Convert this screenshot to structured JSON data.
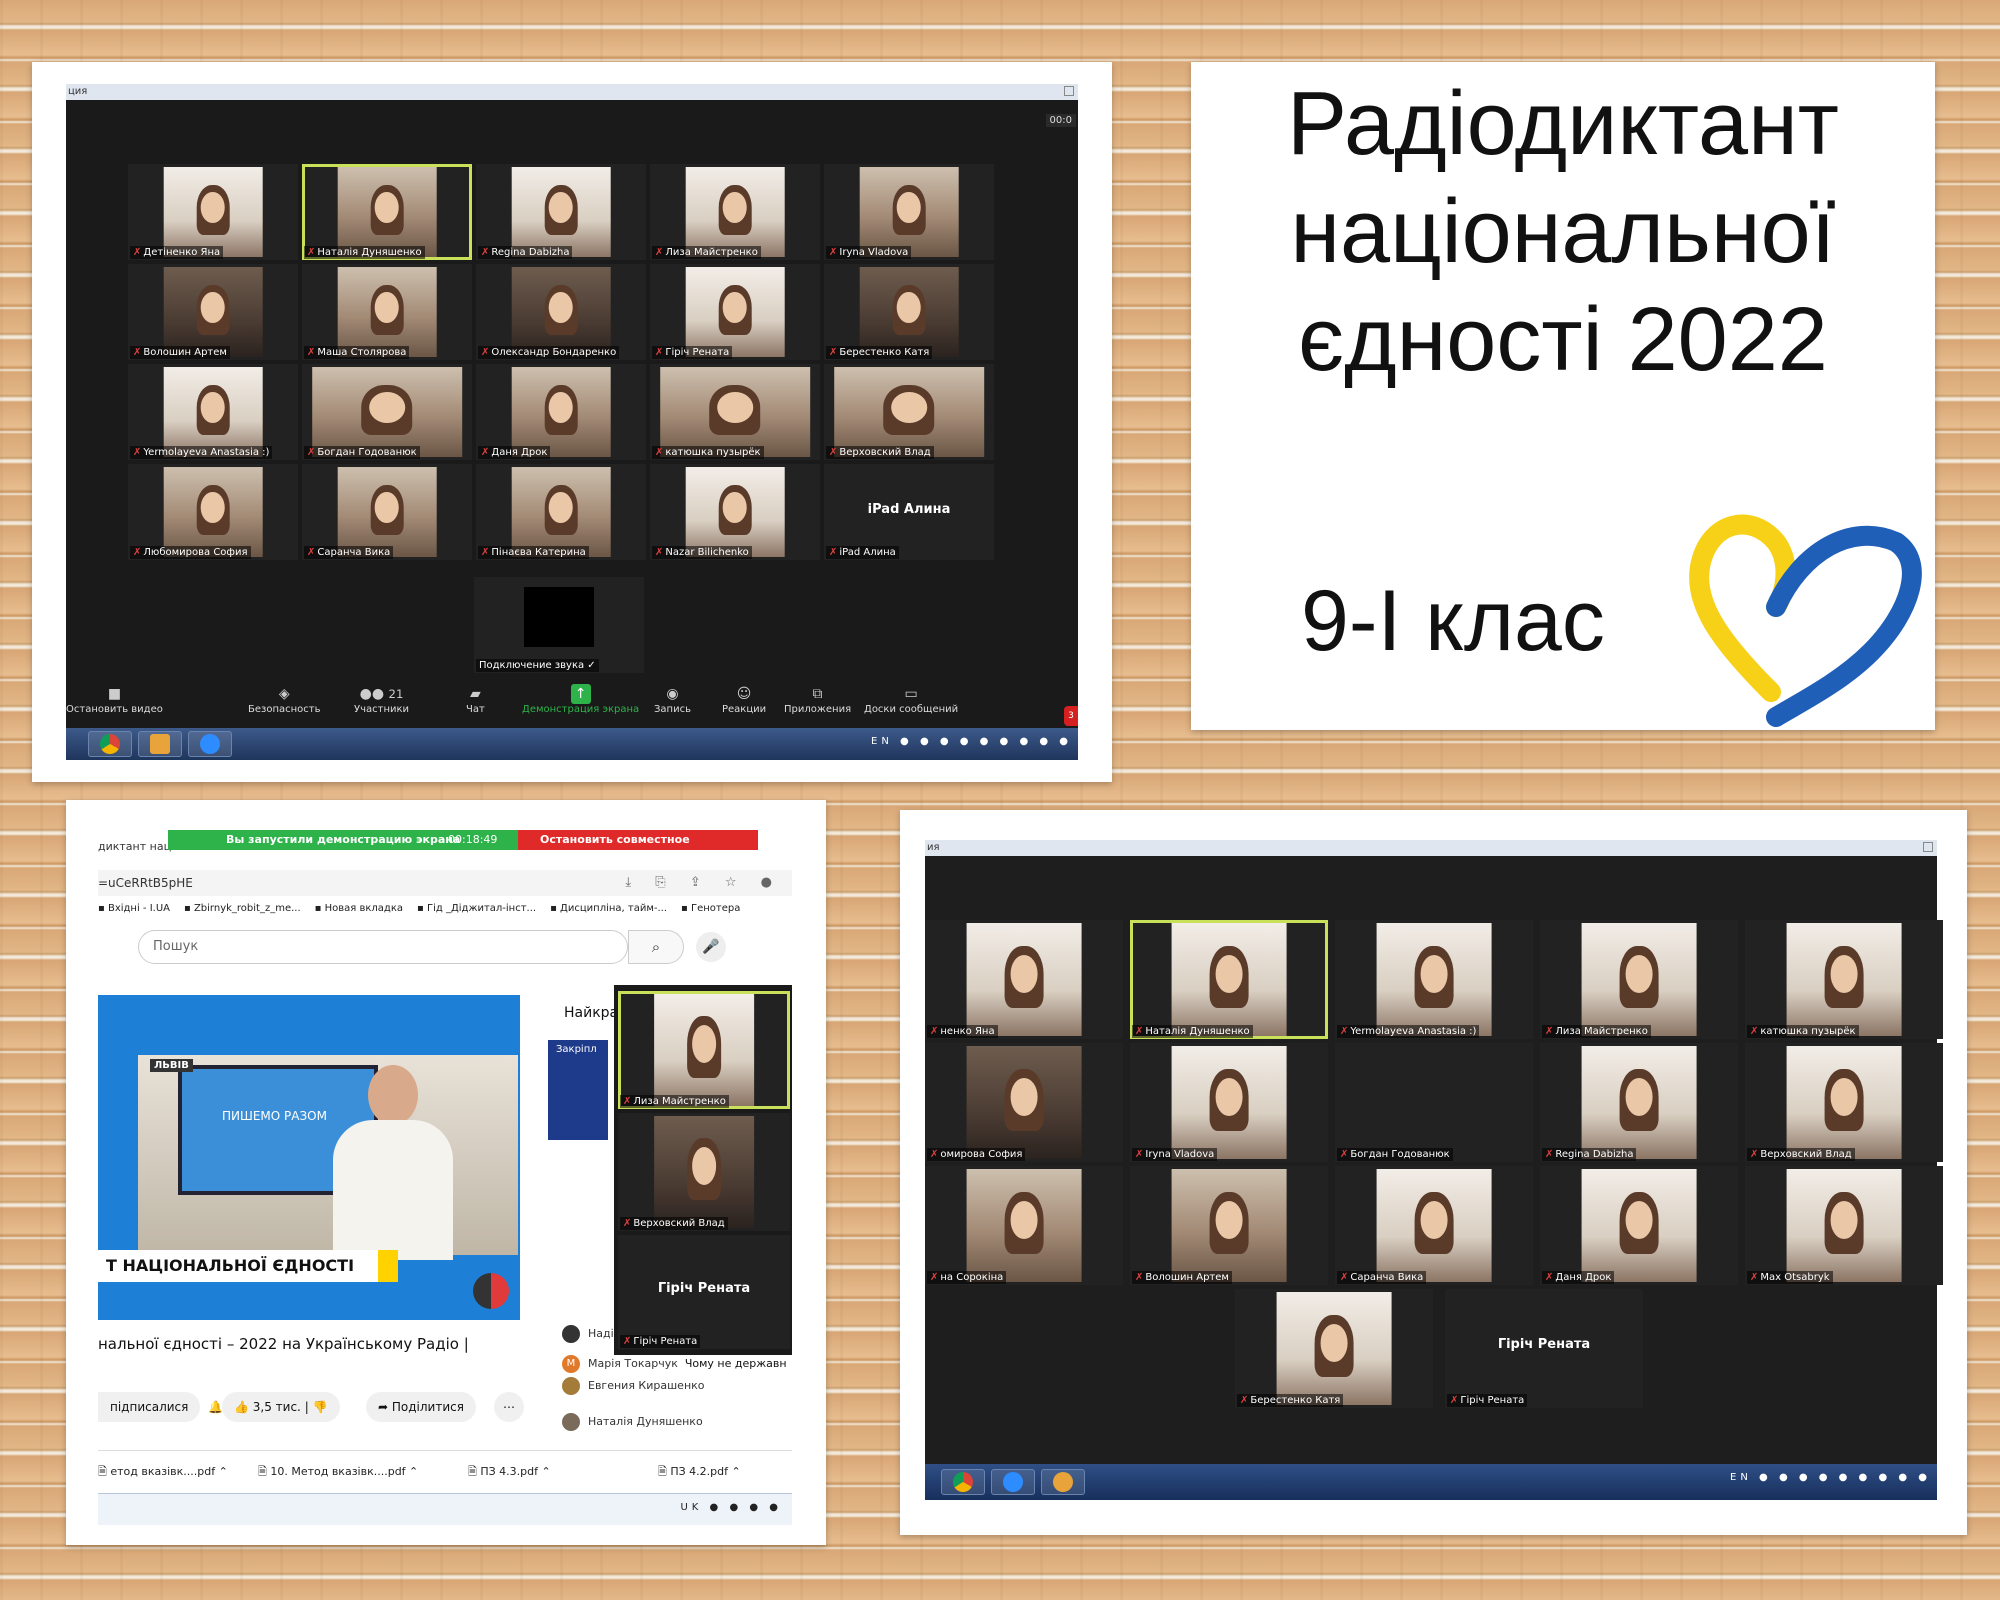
{
  "panel1": {
    "window_title": "ция",
    "timer": "00:0",
    "participants": [
      "Детіненко Яна",
      "Наталія Дуняшенко",
      "Regina Dabizha",
      "Лиза Майстренко",
      "Iryna Vladova",
      "Волошин Артем",
      "Маша Столярова",
      "Олександр Бондаренко",
      "Гіріч Рената",
      "Берестенко Катя",
      "Yermolayeva Anastasia :)",
      "Богдан Годованюк",
      "Даня Дрок",
      "катюшка пузырёк",
      "Верховский Влад",
      "Любомирова София",
      "Саранча Вика",
      "Пінаєва Катерина",
      "Nazar Bilichenko",
      "iPad Алина"
    ],
    "ipad_big": "iPad Алина",
    "audio_tile": "Подключение звука ✓",
    "toolbar": {
      "video": "Остановить видео",
      "security": "Безопасность",
      "participants": "Участники",
      "participants_count": "21",
      "chat": "Чат",
      "share": "Демонстрация экрана",
      "record": "Запись",
      "reactions": "Реакции",
      "apps": "Приложения",
      "whiteboard": "Доски сообщений"
    },
    "tray": "EN"
  },
  "card": {
    "title_line1": "Радіодиктант",
    "title_line2": "національної",
    "title_line3": "єдності 2022",
    "class_label": "9-І клас",
    "colors": {
      "yellow": "#f7d117",
      "blue": "#1f5fb8"
    }
  },
  "panel3": {
    "tab_title": "диктант націон",
    "share_text": "Вы запустили демонстрацию экрана",
    "share_time": "00:18:49",
    "stop_share": "Остановить совместное использование",
    "url": "=uCeRRtB5pHE",
    "bookmarks": [
      "Вхідні - I.UA",
      "Zbirnyk_robit_z_me...",
      "Новая вкладка",
      "Гід _Діджитал-інст...",
      "Дисципліна, тайм-...",
      "Генотера"
    ],
    "search_placeholder": "Пошук",
    "video_location": "ЛЬВІВ",
    "video_screen_text": "ПИШЕМО РАЗОМ",
    "video_lower_third": "Т НАЦІОНАЛЬНОЇ ЄДНОСТІ",
    "video_title": "нальної єдності – 2022 на Українському Радіо |",
    "subscribed": "підписалися",
    "likes": "3,5 тис.",
    "share": "Поділитися",
    "side_header": "Найкра",
    "pinned": "Закріпл",
    "chat": [
      {
        "initial": "М",
        "name": "Марія Токарчук",
        "msg": "Чому не державн"
      },
      {
        "initial": "",
        "name": "Евгения Кирашенко",
        "msg": ""
      },
      {
        "initial": "",
        "name": "Наталія Дуняшенко",
        "msg": ""
      },
      {
        "initial": "",
        "name": "Надія Радіон",
        "msg": ""
      }
    ],
    "zoom_tiles": [
      "Лиза Майстренко",
      "Верховский Влад",
      "Гіріч Рената"
    ],
    "zoom_big": "Гіріч Рената",
    "downloads": [
      "етод вказівк....pdf",
      "10. Метод вказівк....pdf",
      "ПЗ 4.3.pdf",
      "ПЗ 4.2.pdf"
    ],
    "tray": "UK"
  },
  "panel4": {
    "window_title": "ия",
    "participants": [
      "ненко Яна",
      "Наталія Дуняшенко",
      "Yermolayeva Anastasia :)",
      "Лиза Майстренко",
      "катюшка пузырёк",
      "омирова София",
      "Iryna Vladova",
      "Богдан Годованюк",
      "Regina Dabizha",
      "Верховский Влад",
      "на Сорокіна",
      "Волошин Артем",
      "Саранча Вика",
      "Даня Дрок",
      "Max Otsabryk",
      "Берестенко Катя",
      "Гіріч Рената"
    ],
    "big_name": "Гіріч Рената",
    "tray": "EN"
  }
}
